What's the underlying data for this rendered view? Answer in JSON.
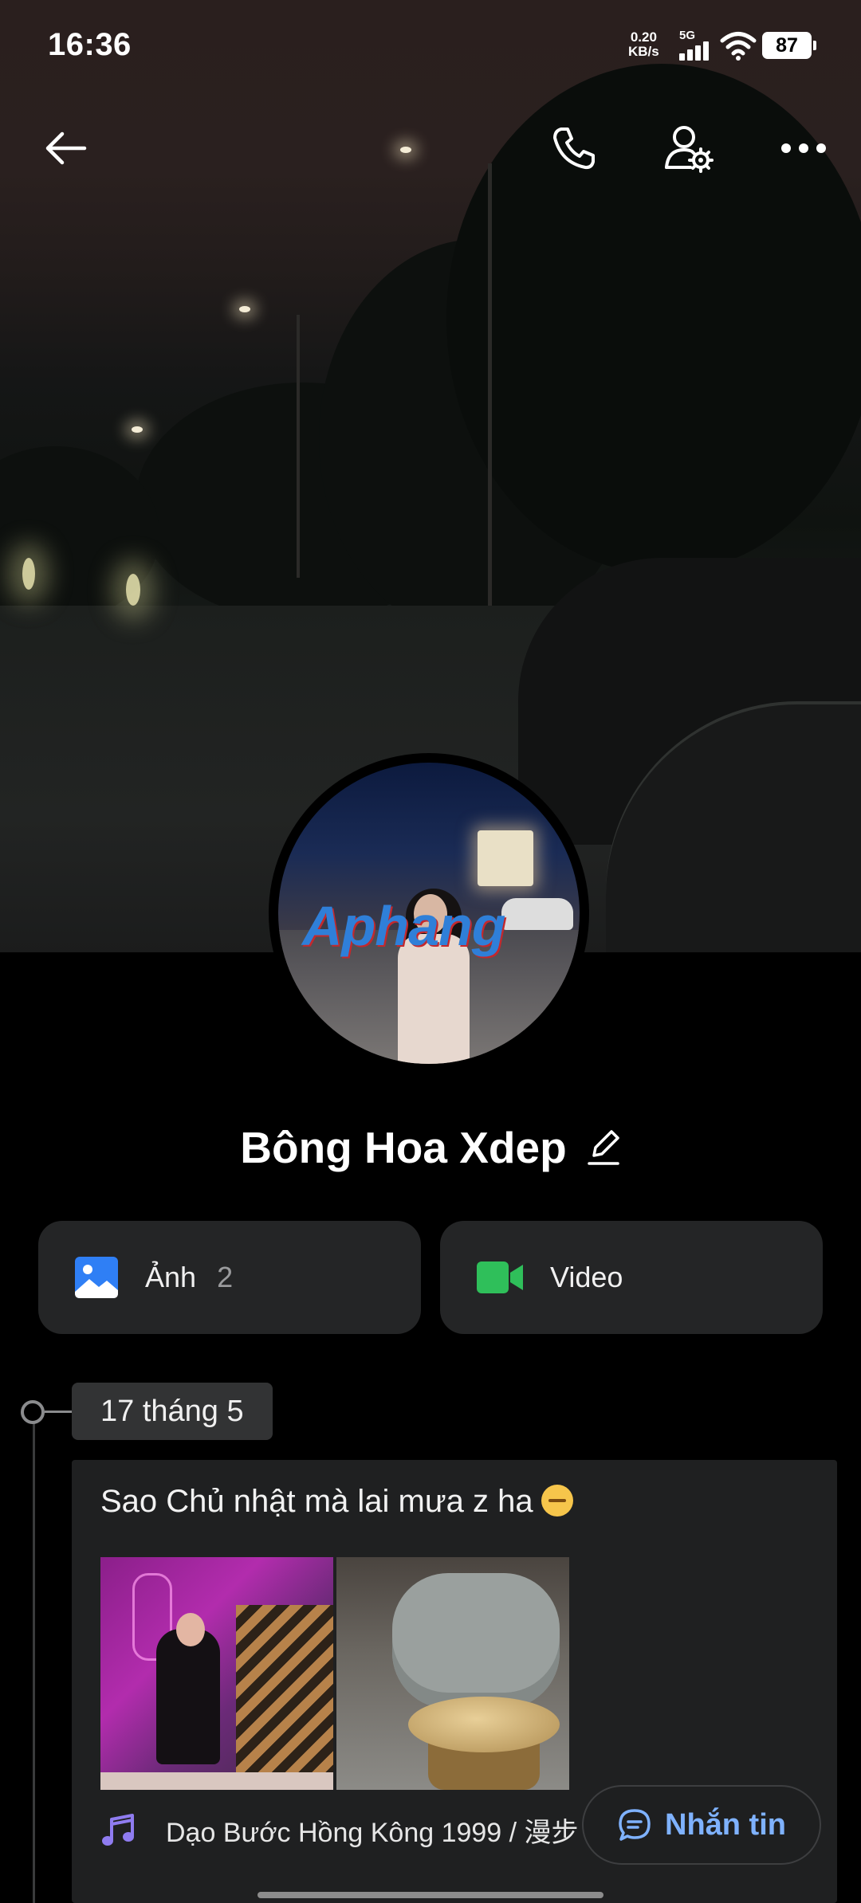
{
  "status_bar": {
    "time": "16:36",
    "net_speed_value": "0.20",
    "net_speed_unit": "KB/s",
    "network": "5G",
    "battery": "87"
  },
  "top_bar": {
    "icons": [
      "back-arrow-icon",
      "phone-icon",
      "user-settings-icon",
      "more-icon"
    ]
  },
  "profile": {
    "name": "Bông Hoa Xdep",
    "avatar_watermark": "Aphang"
  },
  "media": {
    "photos_label": "Ảnh",
    "photos_count": "2",
    "video_label": "Video"
  },
  "timeline": {
    "date": "17 tháng 5",
    "post": {
      "text": "Sao Chủ nhật mà lai mưa z ha",
      "song": "Dạo Bước Hồng Kông 1999 / 漫步"
    }
  },
  "message_button": {
    "label": "Nhắn tin"
  },
  "colors": {
    "accent_blue": "#7fb2ff",
    "photo_icon": "#2f7ff5",
    "video_icon": "#2fbf5a",
    "card_bg": "#242526"
  }
}
